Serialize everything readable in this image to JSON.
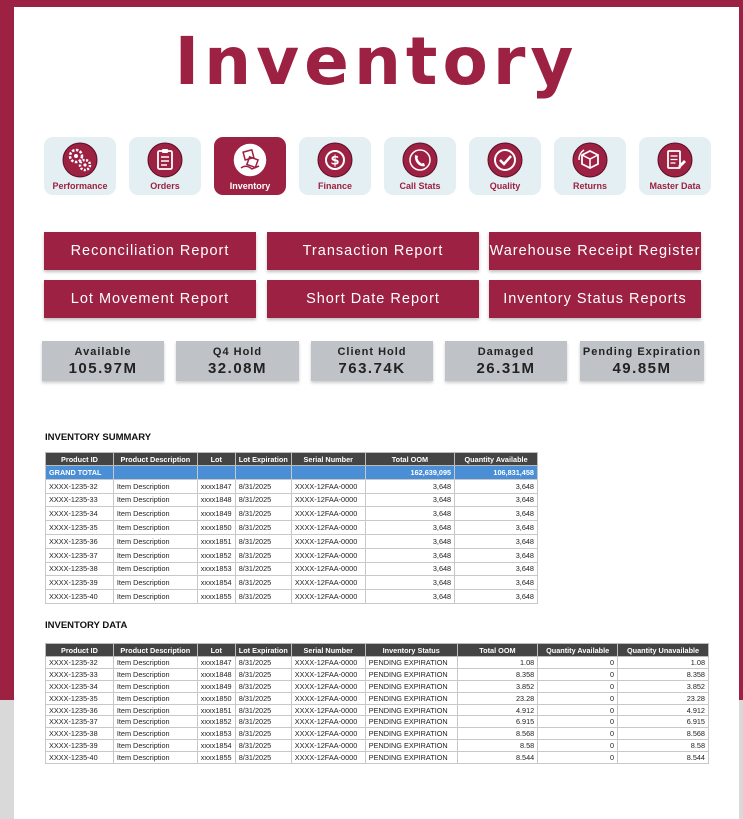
{
  "title": "Inventory",
  "nav": [
    {
      "label": "Performance",
      "icon": "gears-icon",
      "active": false
    },
    {
      "label": "Orders",
      "icon": "clipboard-icon",
      "active": false
    },
    {
      "label": "Inventory",
      "icon": "boxes-icon",
      "active": true
    },
    {
      "label": "Finance",
      "icon": "dollar-icon",
      "active": false
    },
    {
      "label": "Call Stats",
      "icon": "phone-icon",
      "active": false
    },
    {
      "label": "Quality",
      "icon": "check-icon",
      "active": false
    },
    {
      "label": "Returns",
      "icon": "return-box-icon",
      "active": false
    },
    {
      "label": "Master Data",
      "icon": "document-icon",
      "active": false
    }
  ],
  "reports": [
    "Reconciliation Report",
    "Transaction Report",
    "Warehouse Receipt Register",
    "Lot Movement Report",
    "Short Date Report",
    "Inventory Status Reports"
  ],
  "stats": [
    {
      "label": "Available",
      "value": "105.97M"
    },
    {
      "label": "Q4 Hold",
      "value": "32.08M"
    },
    {
      "label": "Client Hold",
      "value": "763.74K"
    },
    {
      "label": "Damaged",
      "value": "26.31M"
    },
    {
      "label": "Pending Expiration",
      "value": "49.85M"
    }
  ],
  "summary": {
    "title": "INVENTORY SUMMARY",
    "headers": [
      "Product ID",
      "Product Description",
      "Lot",
      "Lot Expiration",
      "Serial Number",
      "Total OOM",
      "Quantity Available"
    ],
    "grand_total": [
      "GRAND TOTAL",
      "",
      "",
      "",
      "",
      "162,639,095",
      "106,831,458"
    ],
    "rows": [
      [
        "XXXX-1235-32",
        "Item Description",
        "xxxx1847",
        "8/31/2025",
        "XXXX-12FAA-0000",
        "3,648",
        "3,648"
      ],
      [
        "XXXX-1235-33",
        "Item Description",
        "xxxx1848",
        "8/31/2025",
        "XXXX-12FAA-0000",
        "3,648",
        "3,648"
      ],
      [
        "XXXX-1235-34",
        "Item Description",
        "xxxx1849",
        "8/31/2025",
        "XXXX-12FAA-0000",
        "3,648",
        "3,648"
      ],
      [
        "XXXX-1235-35",
        "Item Description",
        "xxxx1850",
        "8/31/2025",
        "XXXX-12FAA-0000",
        "3,648",
        "3,648"
      ],
      [
        "XXXX-1235-36",
        "Item Description",
        "xxxx1851",
        "8/31/2025",
        "XXXX-12FAA-0000",
        "3,648",
        "3,648"
      ],
      [
        "XXXX-1235-37",
        "Item Description",
        "xxxx1852",
        "8/31/2025",
        "XXXX-12FAA-0000",
        "3,648",
        "3,648"
      ],
      [
        "XXXX-1235-38",
        "Item Description",
        "xxxx1853",
        "8/31/2025",
        "XXXX-12FAA-0000",
        "3,648",
        "3,648"
      ],
      [
        "XXXX-1235-39",
        "Item Description",
        "xxxx1854",
        "8/31/2025",
        "XXXX-12FAA-0000",
        "3,648",
        "3,648"
      ],
      [
        "XXXX-1235-40",
        "Item Description",
        "xxxx1855",
        "8/31/2025",
        "XXXX-12FAA-0000",
        "3,648",
        "3,648"
      ]
    ]
  },
  "data": {
    "title": "INVENTORY DATA",
    "headers": [
      "Product ID",
      "Product Description",
      "Lot",
      "Lot Expiration",
      "Serial Number",
      "Inventory Status",
      "Total OOM",
      "Quantity Available",
      "Quantity Unavailable"
    ],
    "rows": [
      [
        "XXXX-1235-32",
        "Item Description",
        "xxxx1847",
        "8/31/2025",
        "XXXX-12FAA-0000",
        "PENDING EXPIRATION",
        "1.08",
        "0",
        "1.08"
      ],
      [
        "XXXX-1235-33",
        "Item Description",
        "xxxx1848",
        "8/31/2025",
        "XXXX-12FAA-0000",
        "PENDING EXPIRATION",
        "8.358",
        "0",
        "8.358"
      ],
      [
        "XXXX-1235-34",
        "Item Description",
        "xxxx1849",
        "8/31/2025",
        "XXXX-12FAA-0000",
        "PENDING EXPIRATION",
        "3.852",
        "0",
        "3.852"
      ],
      [
        "XXXX-1235-35",
        "Item Description",
        "xxxx1850",
        "8/31/2025",
        "XXXX-12FAA-0000",
        "PENDING EXPIRATION",
        "23.28",
        "0",
        "23.28"
      ],
      [
        "XXXX-1235-36",
        "Item Description",
        "xxxx1851",
        "8/31/2025",
        "XXXX-12FAA-0000",
        "PENDING EXPIRATION",
        "4.912",
        "0",
        "4.912"
      ],
      [
        "XXXX-1235-37",
        "Item Description",
        "xxxx1852",
        "8/31/2025",
        "XXXX-12FAA-0000",
        "PENDING EXPIRATION",
        "6.915",
        "0",
        "6.915"
      ],
      [
        "XXXX-1235-38",
        "Item Description",
        "xxxx1853",
        "8/31/2025",
        "XXXX-12FAA-0000",
        "PENDING EXPIRATION",
        "8.568",
        "0",
        "8.568"
      ],
      [
        "XXXX-1235-39",
        "Item Description",
        "xxxx1854",
        "8/31/2025",
        "XXXX-12FAA-0000",
        "PENDING EXPIRATION",
        "8.58",
        "0",
        "8.58"
      ],
      [
        "XXXX-1235-40",
        "Item Description",
        "xxxx1855",
        "8/31/2025",
        "XXXX-12FAA-0000",
        "PENDING EXPIRATION",
        "8.544",
        "0",
        "8.544"
      ]
    ]
  },
  "colors": {
    "brand": "#9c2142",
    "tile_bg": "#e3eff3",
    "stat_bg": "#bfc3c8",
    "grand_total": "#4a8fd6",
    "header": "#444444"
  }
}
